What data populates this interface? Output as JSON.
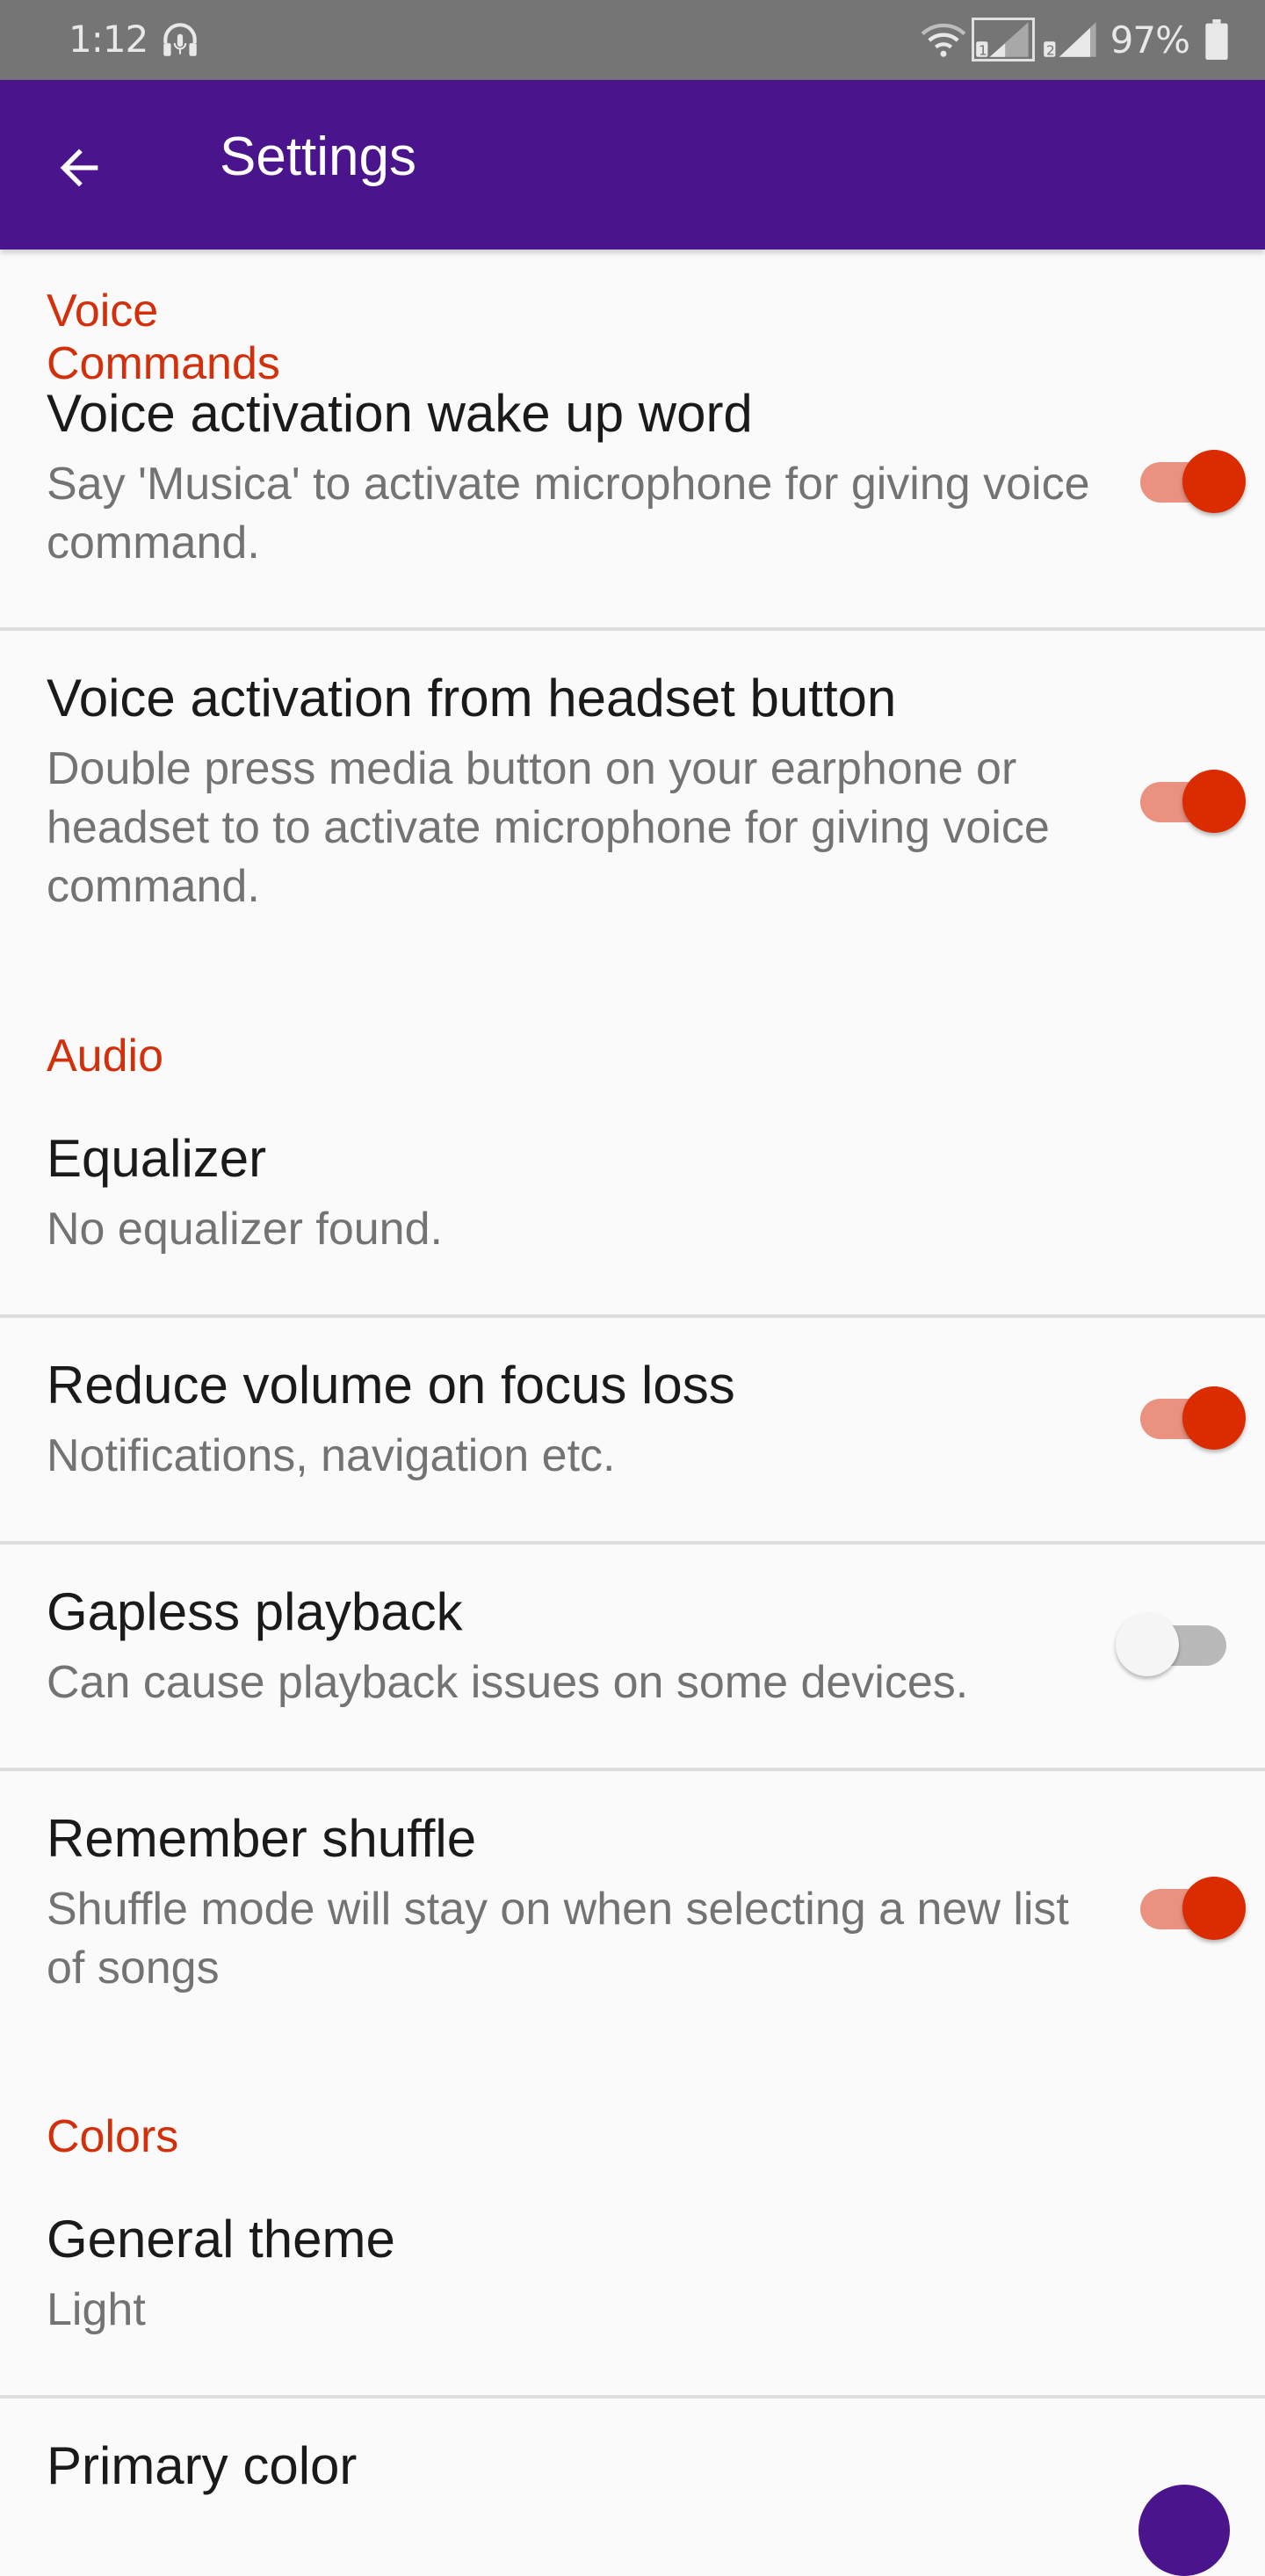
{
  "status_bar": {
    "time": "1:12",
    "headset_icon": "headset-mic-icon",
    "wifi_icon": "wifi-icon",
    "sim1_label": "1",
    "sim2_label": "2",
    "battery_percent": "97%",
    "battery_icon": "battery-icon"
  },
  "app_bar": {
    "title": "Settings",
    "back_icon": "arrow-back-icon",
    "background": "#4a148c"
  },
  "colors": {
    "accent": "#da2c00",
    "accent_track": "#eb9180",
    "section_header": "#d32f0a",
    "primary": "#4a148c",
    "switch_off_track": "#b9b9b9",
    "switch_off_thumb": "#f5f5f5"
  },
  "sections": [
    {
      "header": "Voice Commands",
      "items": [
        {
          "title": "Voice activation wake up word",
          "summary": "Say 'Musica' to activate microphone for giving voice command.",
          "widget": "switch",
          "checked": true
        },
        {
          "title": "Voice activation from headset button",
          "summary": "Double press media button on your earphone or headset to to activate microphone for giving voice command.",
          "widget": "switch",
          "checked": true
        }
      ]
    },
    {
      "header": "Audio",
      "items": [
        {
          "title": "Equalizer",
          "summary": "No equalizer found.",
          "widget": "none"
        },
        {
          "title": "Reduce volume on focus loss",
          "summary": "Notifications, navigation etc.",
          "widget": "switch",
          "checked": true
        },
        {
          "title": "Gapless playback",
          "summary": "Can cause playback issues on some devices.",
          "widget": "switch",
          "checked": false
        },
        {
          "title": "Remember shuffle",
          "summary": "Shuffle mode will stay on when selecting a new list of songs",
          "widget": "switch",
          "checked": true
        }
      ]
    },
    {
      "header": "Colors",
      "items": [
        {
          "title": "General theme",
          "summary": "Light",
          "widget": "none"
        },
        {
          "title": "Primary color",
          "summary": "",
          "widget": "color-swatch",
          "color": "#4a148c"
        }
      ]
    }
  ]
}
